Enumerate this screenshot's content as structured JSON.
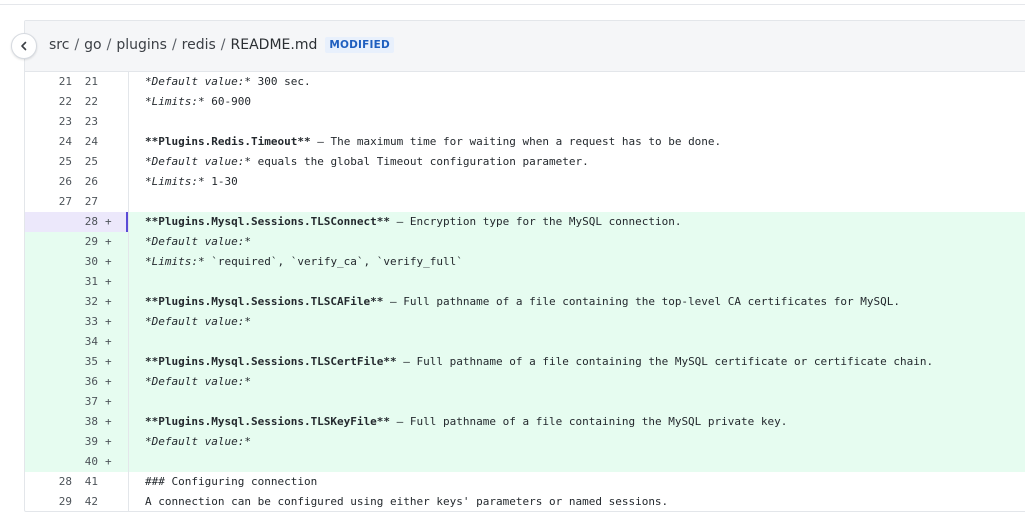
{
  "header": {
    "breadcrumb": [
      "src",
      "go",
      "plugins",
      "redis"
    ],
    "file_name": "README.md",
    "badge": "MODIFIED"
  },
  "lines": [
    {
      "old": "21",
      "new": "21",
      "type": "context",
      "segments": [
        {
          "t": "*Default value:*",
          "s": "i"
        },
        {
          "t": " 300 sec."
        }
      ]
    },
    {
      "old": "22",
      "new": "22",
      "type": "context",
      "segments": [
        {
          "t": "*Limits:*",
          "s": "i"
        },
        {
          "t": " 60-900"
        }
      ]
    },
    {
      "old": "23",
      "new": "23",
      "type": "context",
      "segments": []
    },
    {
      "old": "24",
      "new": "24",
      "type": "context",
      "segments": [
        {
          "t": "**Plugins.Redis.Timeout**",
          "s": "b"
        },
        {
          "t": " — The maximum time for waiting when a request has to be done."
        }
      ]
    },
    {
      "old": "25",
      "new": "25",
      "type": "context",
      "segments": [
        {
          "t": "*Default value:*",
          "s": "i"
        },
        {
          "t": " equals the global Timeout configuration parameter."
        }
      ]
    },
    {
      "old": "26",
      "new": "26",
      "type": "context",
      "segments": [
        {
          "t": "*Limits:*",
          "s": "i"
        },
        {
          "t": " 1-30"
        }
      ]
    },
    {
      "old": "27",
      "new": "27",
      "type": "context",
      "segments": []
    },
    {
      "old": "",
      "new": "28",
      "type": "added",
      "active": true,
      "segments": [
        {
          "t": "**Plugins.Mysql.Sessions.TLSConnect**",
          "s": "b"
        },
        {
          "t": " — Encryption type for the MySQL connection."
        }
      ]
    },
    {
      "old": "",
      "new": "29",
      "type": "added",
      "segments": [
        {
          "t": "*Default value:*",
          "s": "i"
        }
      ]
    },
    {
      "old": "",
      "new": "30",
      "type": "added",
      "segments": [
        {
          "t": "*Limits:*",
          "s": "i"
        },
        {
          "t": " `required`, `verify_ca`, `verify_full`"
        }
      ]
    },
    {
      "old": "",
      "new": "31",
      "type": "added",
      "segments": []
    },
    {
      "old": "",
      "new": "32",
      "type": "added",
      "segments": [
        {
          "t": "**Plugins.Mysql.Sessions.TLSCAFile**",
          "s": "b"
        },
        {
          "t": " — Full pathname of a file containing the top-level CA certificates for MySQL."
        }
      ]
    },
    {
      "old": "",
      "new": "33",
      "type": "added",
      "segments": [
        {
          "t": "*Default value:*",
          "s": "i"
        }
      ]
    },
    {
      "old": "",
      "new": "34",
      "type": "added",
      "segments": []
    },
    {
      "old": "",
      "new": "35",
      "type": "added",
      "segments": [
        {
          "t": "**Plugins.Mysql.Sessions.TLSCertFile**",
          "s": "b"
        },
        {
          "t": " — Full pathname of a file containing the MySQL certificate or certificate chain."
        }
      ]
    },
    {
      "old": "",
      "new": "36",
      "type": "added",
      "segments": [
        {
          "t": "*Default value:*",
          "s": "i"
        }
      ]
    },
    {
      "old": "",
      "new": "37",
      "type": "added",
      "segments": []
    },
    {
      "old": "",
      "new": "38",
      "type": "added",
      "segments": [
        {
          "t": "**Plugins.Mysql.Sessions.TLSKeyFile**",
          "s": "b"
        },
        {
          "t": " — Full pathname of a file containing the MySQL private key."
        }
      ]
    },
    {
      "old": "",
      "new": "39",
      "type": "added",
      "segments": [
        {
          "t": "*Default value:*",
          "s": "i"
        }
      ]
    },
    {
      "old": "",
      "new": "40",
      "type": "added",
      "segments": []
    },
    {
      "old": "28",
      "new": "41",
      "type": "context",
      "segments": [
        {
          "t": "### Configuring connection"
        }
      ]
    },
    {
      "old": "29",
      "new": "42",
      "type": "context",
      "segments": [
        {
          "t": "A connection can be configured using either keys' parameters or named sessions."
        }
      ]
    }
  ],
  "added_sign": "+",
  "colors": {
    "added_bg": "#e6fcf0",
    "active_marker": "#5b4bd6",
    "badge_text": "#1f5fbf"
  }
}
